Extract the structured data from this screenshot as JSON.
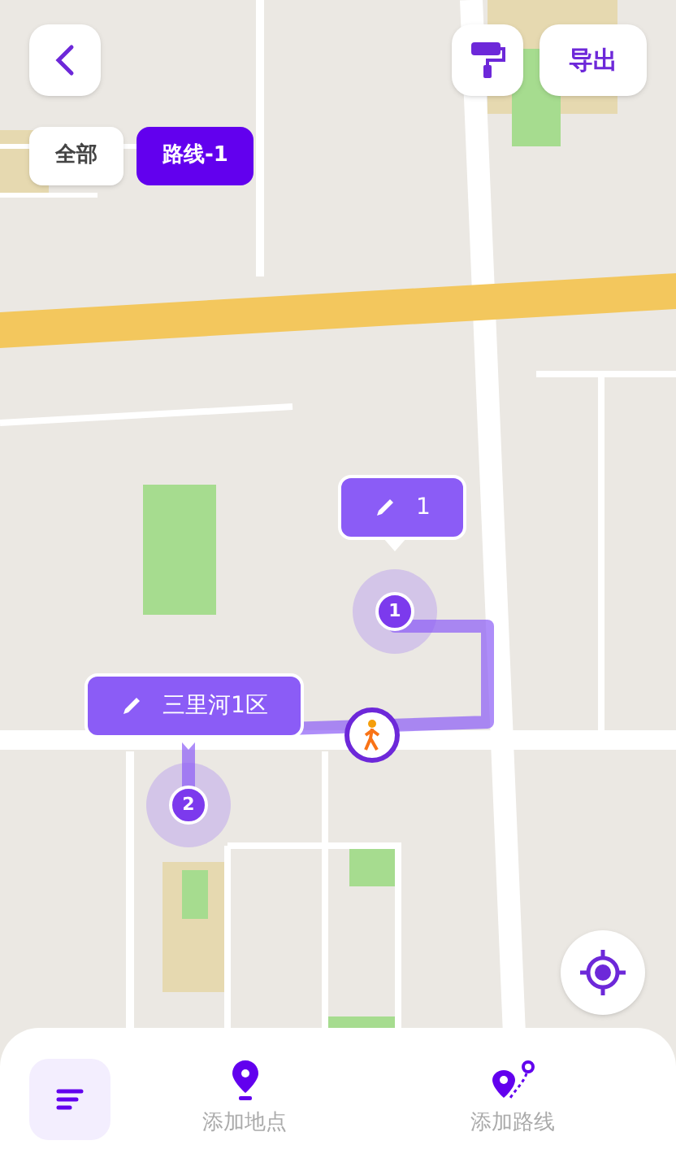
{
  "toolbar": {
    "export_label": "导出"
  },
  "filter_tabs": [
    {
      "label": "全部",
      "selected": false
    },
    {
      "label": "路线-1",
      "selected": true
    }
  ],
  "map": {
    "stops": [
      {
        "number": "1",
        "label": "1"
      },
      {
        "number": "2",
        "label": "三里河1区"
      }
    ]
  },
  "bottom_bar": {
    "items": [
      {
        "kind": "list",
        "selected": true
      },
      {
        "kind": "place",
        "label": "添加地点",
        "selected": false
      },
      {
        "kind": "route",
        "label": "添加路线",
        "selected": false
      }
    ]
  }
}
